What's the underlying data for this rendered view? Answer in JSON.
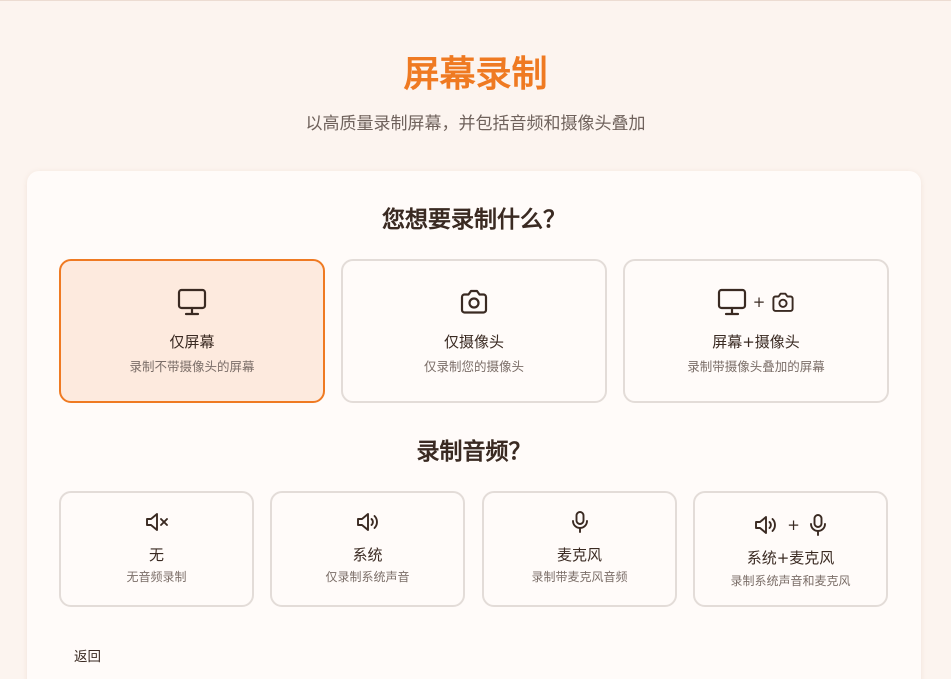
{
  "header": {
    "title": "屏幕录制",
    "subtitle": "以高质量录制屏幕，并包括音频和摄像头叠加"
  },
  "video_section": {
    "title": "您想要录制什么？",
    "options": [
      {
        "label": "仅屏幕",
        "description": "录制不带摄像头的屏幕",
        "icons": [
          "monitor-icon"
        ],
        "selected": true
      },
      {
        "label": "仅摄像头",
        "description": "仅录制您的摄像头",
        "icons": [
          "camera-icon"
        ],
        "selected": false
      },
      {
        "label": "屏幕+摄像头",
        "description": "录制带摄像头叠加的屏幕",
        "icons": [
          "monitor-icon",
          "camera-icon"
        ],
        "plus": "+",
        "selected": false
      }
    ]
  },
  "audio_section": {
    "title": "录制音频？",
    "options": [
      {
        "label": "无",
        "description": "无音频录制",
        "icons": [
          "speaker-muted-icon"
        ]
      },
      {
        "label": "系统",
        "description": "仅录制系统声音",
        "icons": [
          "speaker-icon"
        ]
      },
      {
        "label": "麦克风",
        "description": "录制带麦克风音频",
        "icons": [
          "microphone-icon"
        ]
      },
      {
        "label": "系统+麦克风",
        "description": "录制系统声音和麦克风",
        "icons": [
          "speaker-icon",
          "microphone-icon"
        ],
        "plus": "+"
      }
    ]
  },
  "footer": {
    "back_label": "返回"
  },
  "colors": {
    "accent": "#ef7a22",
    "selected_background": "#fdeade",
    "page_background": "#fcf4ef"
  }
}
